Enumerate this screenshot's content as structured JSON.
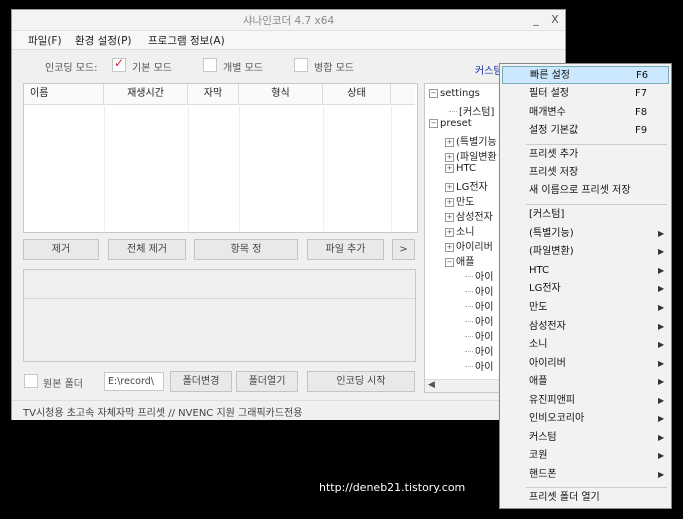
{
  "window": {
    "title": "샤나인코더  4.7  x64",
    "minimize": "_",
    "close": "X"
  },
  "menu": [
    "파일(F)",
    "환경 설정(P)",
    "프로그램 정보(A)"
  ],
  "mode": {
    "label": "인코딩 모드:",
    "options": [
      {
        "label": "기본 모드",
        "checked": true
      },
      {
        "label": "개별 모드",
        "checked": false
      },
      {
        "label": "병합 모드",
        "checked": false
      }
    ]
  },
  "custom_link": "커스텀",
  "list": {
    "columns": [
      "이름",
      "재생시간",
      "자막",
      "형식",
      "상태"
    ]
  },
  "actions": {
    "remove": "제거",
    "remove_all": "전체 제거",
    "item_settings": "항목    정",
    "add_file": "파일 추가",
    "more": ">"
  },
  "bottom": {
    "source_folder_label": "원본 폴더",
    "path": "E:\\record\\",
    "change_folder": "폴더변경",
    "open_folder": "폴더열기",
    "start": "인코딩 시작"
  },
  "status": "TV시청용 초고속 자체자막 프리셋 // NVENC 지원 그래픽카드전용",
  "tree": {
    "settings": "settings",
    "custom": "[커스텀]",
    "preset": "preset",
    "groups": [
      "(특별기능",
      "(파일변환",
      "HTC",
      "LG전자",
      "만도",
      "삼성전자",
      "소니",
      "아이리버",
      "애플"
    ],
    "apple_children": [
      "아이",
      "아이",
      "아이",
      "아이",
      "아이",
      "아이",
      "아이"
    ]
  },
  "context_menu": {
    "items_top": [
      {
        "label": "빠른 설정",
        "key": "F6"
      },
      {
        "label": "필터 설정",
        "key": "F7"
      },
      {
        "label": "매개변수",
        "key": "F8"
      },
      {
        "label": "설정 기본값",
        "key": "F9"
      }
    ],
    "items_preset": [
      "프리셋 추가",
      "프리셋 저장",
      "새 이름으로 프리셋 저장"
    ],
    "items_groups": [
      {
        "label": "[커스텀]",
        "submenu": false
      },
      {
        "label": "(특별기능)",
        "submenu": true
      },
      {
        "label": "(파일변환)",
        "submenu": true
      },
      {
        "label": "HTC",
        "submenu": true
      },
      {
        "label": "LG전자",
        "submenu": true
      },
      {
        "label": "만도",
        "submenu": true
      },
      {
        "label": "삼성전자",
        "submenu": true
      },
      {
        "label": "소니",
        "submenu": true
      },
      {
        "label": "아이리버",
        "submenu": true
      },
      {
        "label": "애플",
        "submenu": true
      },
      {
        "label": "유진피앤피",
        "submenu": true
      },
      {
        "label": "인비오코리아",
        "submenu": true
      },
      {
        "label": "커스텀",
        "submenu": true
      },
      {
        "label": "코원",
        "submenu": true
      },
      {
        "label": "핸드폰",
        "submenu": true
      }
    ],
    "open_folder": "프리셋 폴더 열기",
    "submenu_arrow": "▶"
  },
  "watermark": "http://deneb21.tistory.com",
  "colors": {
    "highlight": "#cce8ff",
    "link": "#1a33aa",
    "check": "#dd2233"
  }
}
